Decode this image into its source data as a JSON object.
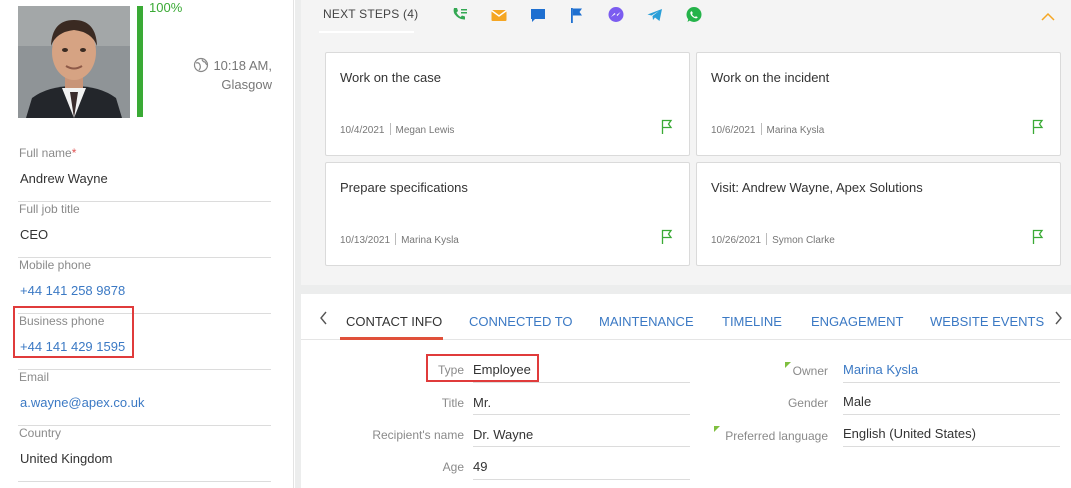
{
  "profile": {
    "completeness": "100%",
    "completeness_fraction": 1.0,
    "local_time": "10:18 AM,",
    "city": "Glasgow",
    "fields": [
      {
        "label": "Full name",
        "required": "*",
        "value": "Andrew Wayne",
        "link": false
      },
      {
        "label": "Full job title",
        "value": "CEO",
        "link": false
      },
      {
        "label": "Mobile phone",
        "value": "+44 141 258 9878",
        "link": true
      },
      {
        "label": "Business phone",
        "value": "+44 141 429 1595",
        "link": true
      },
      {
        "label": "Email",
        "value": "a.wayne@apex.co.uk",
        "link": true
      },
      {
        "label": "Country",
        "value": "United Kingdom",
        "link": false
      }
    ]
  },
  "next_steps": {
    "title": "NEXT STEPS (4)",
    "icons": [
      "phone-list-icon",
      "email-icon",
      "chat-icon",
      "flag-icon",
      "messenger-icon",
      "telegram-icon",
      "whatsapp-icon"
    ],
    "cards": [
      {
        "title": "Work on the case",
        "date": "10/4/2021",
        "owner": "Megan Lewis"
      },
      {
        "title": "Work on the incident",
        "date": "10/6/2021",
        "owner": "Marina Kysla"
      },
      {
        "title": "Prepare specifications",
        "date": "10/13/2021",
        "owner": "Marina Kysla"
      },
      {
        "title": "Visit: Andrew Wayne, Apex Solutions",
        "date": "10/26/2021",
        "owner": "Symon Clarke"
      }
    ]
  },
  "tabs": [
    "CONTACT INFO",
    "CONNECTED TO",
    "MAINTENANCE",
    "TIMELINE",
    "ENGAGEMENT",
    "WEBSITE EVENTS"
  ],
  "contact_info": {
    "left": [
      {
        "label": "Type",
        "value": "Employee"
      },
      {
        "label": "Title",
        "value": "Mr."
      },
      {
        "label": "Recipient's name",
        "value": "Dr. Wayne"
      },
      {
        "label": "Age",
        "value": "49"
      }
    ],
    "right": [
      {
        "label": "Owner",
        "value": "Marina Kysla",
        "link": true
      },
      {
        "label": "Gender",
        "value": "Male",
        "link": false
      },
      {
        "label": "Preferred language",
        "value": "English (United States)",
        "link": false
      }
    ]
  },
  "colors": {
    "accent_green": "#3aaa35",
    "link_blue": "#3b79c4",
    "highlight_red": "#e03b3b",
    "tab_underline": "#e0503a"
  }
}
